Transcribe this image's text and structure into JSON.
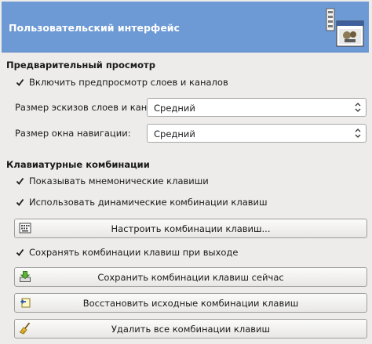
{
  "header": {
    "title": "Пользовательский интерфейс",
    "icon": "preferences-interface-icon"
  },
  "preview": {
    "section_title": "Предварительный просмотр",
    "enable_preview": {
      "label": "Включить предпросмотр слоев и каналов",
      "checked": true
    },
    "thumbnail_size": {
      "label": "Размер эскизов слоев и каналов:",
      "value": "Средний"
    },
    "navigation_size": {
      "label": "Размер окна навигации:",
      "value": "Средний"
    }
  },
  "shortcuts": {
    "section_title": "Клавиатурные комбинации",
    "show_mnemonics": {
      "label": "Показывать мнемонические клавиши",
      "checked": true
    },
    "dynamic_shortcuts": {
      "label": "Использовать динамические комбинации клавиш",
      "checked": true
    },
    "configure_button": "Настроить комбинации клавиш...",
    "save_on_exit": {
      "label": "Сохранять комбинации клавиш при выходе",
      "checked": true
    },
    "save_now_button": "Сохранить комбинации клавиш сейчас",
    "restore_button": "Восстановить исходные комбинации клавиш",
    "clear_button": "Удалить все комбинации клавиш"
  }
}
